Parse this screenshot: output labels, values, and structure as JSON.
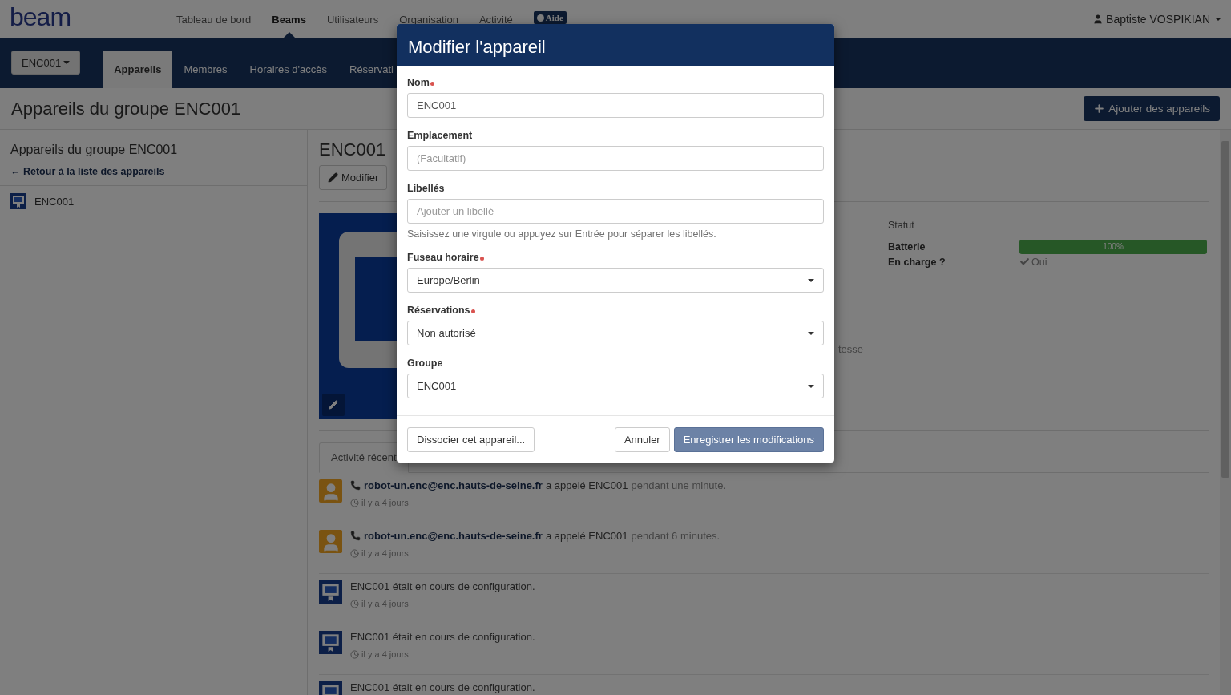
{
  "topnav": {
    "logo": "beam",
    "links": [
      {
        "label": "Tableau de bord",
        "selected": false
      },
      {
        "label": "Beams",
        "selected": true
      },
      {
        "label": "Utilisateurs",
        "selected": false
      },
      {
        "label": "Organisation",
        "selected": false
      },
      {
        "label": "Activité",
        "selected": false
      }
    ],
    "help": "Aide",
    "user": "Baptiste VOSPIKIAN"
  },
  "subnav": {
    "group_button": "ENC001",
    "tabs": [
      {
        "label": "Appareils",
        "selected": true
      },
      {
        "label": "Membres",
        "selected": false
      },
      {
        "label": "Horaires d'accès",
        "selected": false
      },
      {
        "label": "Réservati",
        "selected": false
      }
    ]
  },
  "page_header": {
    "title": "Appareils du groupe ENC001",
    "add_button": "Ajouter des appareils"
  },
  "sidebar": {
    "title": "Appareils du groupe ENC001",
    "back_link": "← Retour à la liste des appareils",
    "items": [
      {
        "label": "ENC001"
      }
    ]
  },
  "device": {
    "name": "ENC001",
    "edit_button": "Modifier",
    "status_title": "Statut",
    "status_rows": [
      {
        "kind": "meter",
        "label": "Batterie",
        "level": 1,
        "reading": "100%"
      },
      {
        "kind": "check",
        "label": "En charge ?",
        "value": "Oui"
      }
    ],
    "fragments": [
      "tesse"
    ]
  },
  "activity": {
    "tab": "Activité récent",
    "items": [
      {
        "kind": "call",
        "actor": "robot-un.enc@enc.hauts-de-seine.fr",
        "action": "a appelé ENC001",
        "detail": "pendant une minute.",
        "time": "il y a 4 jours"
      },
      {
        "kind": "call",
        "actor": "robot-un.enc@enc.hauts-de-seine.fr",
        "action": "a appelé ENC001",
        "detail": "pendant 6 minutes.",
        "time": "il y a 4 jours"
      },
      {
        "kind": "config",
        "action": "ENC001 était en cours de configuration.",
        "time": "il y a 4 jours"
      },
      {
        "kind": "config",
        "action": "ENC001 était en cours de configuration.",
        "time": "il y a 4 jours"
      },
      {
        "kind": "config",
        "action": "ENC001 était en cours de configuration."
      }
    ]
  },
  "modal": {
    "title": "Modifier l'appareil",
    "fields": [
      {
        "kind": "text",
        "label": "Nom",
        "required": true,
        "value": "ENC001"
      },
      {
        "kind": "text",
        "label": "Emplacement",
        "required": false,
        "placeholder": "(Facultatif)"
      },
      {
        "kind": "text",
        "label": "Libellés",
        "required": false,
        "placeholder": "Ajouter un libellé",
        "help": "Saisissez une virgule ou appuyez sur Entrée pour séparer les libellés."
      },
      {
        "kind": "select",
        "label": "Fuseau horaire",
        "required": true,
        "value": "Europe/Berlin"
      },
      {
        "kind": "select",
        "label": "Réservations",
        "required": true,
        "value": "Non autorisé"
      },
      {
        "kind": "select",
        "label": "Groupe",
        "required": false,
        "value": "ENC001"
      }
    ],
    "dissociate_button": "Dissocier cet appareil...",
    "cancel_button": "Annuler",
    "save_button": "Enregistrer les modifications"
  }
}
